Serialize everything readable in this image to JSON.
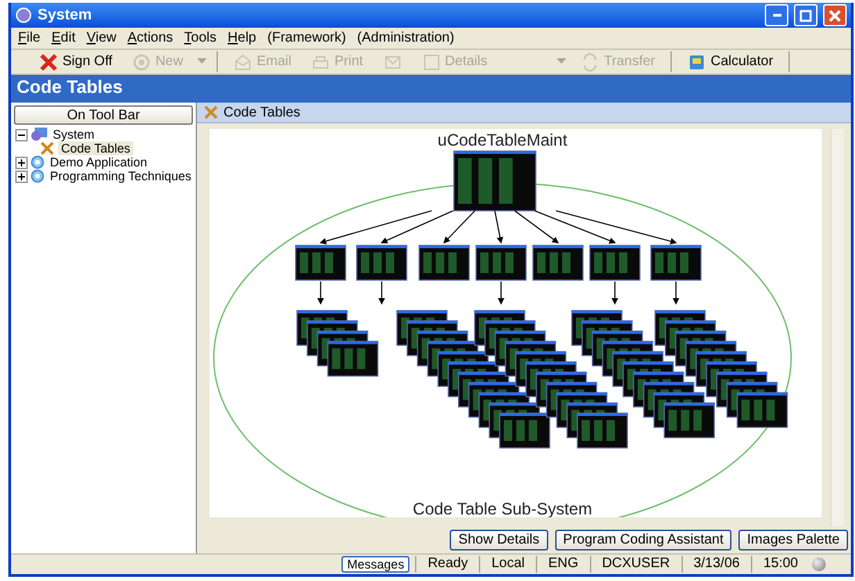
{
  "window": {
    "title": "System"
  },
  "menu": [
    {
      "label": "File",
      "kind": "mnemonic"
    },
    {
      "label": "Edit",
      "kind": "mnemonic"
    },
    {
      "label": "View",
      "kind": "mnemonic"
    },
    {
      "label": "Actions",
      "kind": "mnemonic"
    },
    {
      "label": "Tools",
      "kind": "mnemonic"
    },
    {
      "label": "Help",
      "kind": "mnemonic"
    },
    {
      "label": "(Framework)",
      "kind": "plain"
    },
    {
      "label": "(Administration)",
      "kind": "plain"
    }
  ],
  "toolbar": [
    {
      "kind": "button",
      "label": "Sign Off",
      "disabled": false
    },
    {
      "kind": "button",
      "label": "New",
      "disabled": true,
      "dropdown": true
    },
    {
      "kind": "separator"
    },
    {
      "kind": "button",
      "label": "Email",
      "disabled": true
    },
    {
      "kind": "button",
      "label": "Print",
      "disabled": true
    },
    {
      "kind": "icon",
      "disabled": true
    },
    {
      "kind": "button",
      "label": "Details",
      "disabled": true,
      "dropdown": true
    },
    {
      "kind": "button",
      "label": "Transfer",
      "disabled": true
    },
    {
      "kind": "separator"
    },
    {
      "kind": "button",
      "label": "Calculator",
      "disabled": false
    },
    {
      "kind": "separator"
    }
  ],
  "header": {
    "title": "Code Tables"
  },
  "sidebar": {
    "button": "On Tool Bar",
    "tree": [
      {
        "label": "System",
        "expanded": true,
        "selected": false,
        "children": [
          {
            "label": "Code Tables",
            "selected": true
          }
        ]
      },
      {
        "label": "Demo Application",
        "expanded": false,
        "selected": false
      },
      {
        "label": "Programming Techniques",
        "expanded": false,
        "selected": false
      }
    ]
  },
  "content": {
    "tab": "Code Tables",
    "diagram": {
      "title": "uCodeTableMaint",
      "caption": "Code Table Sub-System"
    }
  },
  "buttons": [
    "Show Details",
    "Program Coding Assistant",
    "Images Palette"
  ],
  "status_bar": {
    "messages": "Messages",
    "fields": [
      "Ready",
      "Local",
      "ENG",
      "DCXUSER",
      "3/13/06",
      "15:00"
    ]
  }
}
